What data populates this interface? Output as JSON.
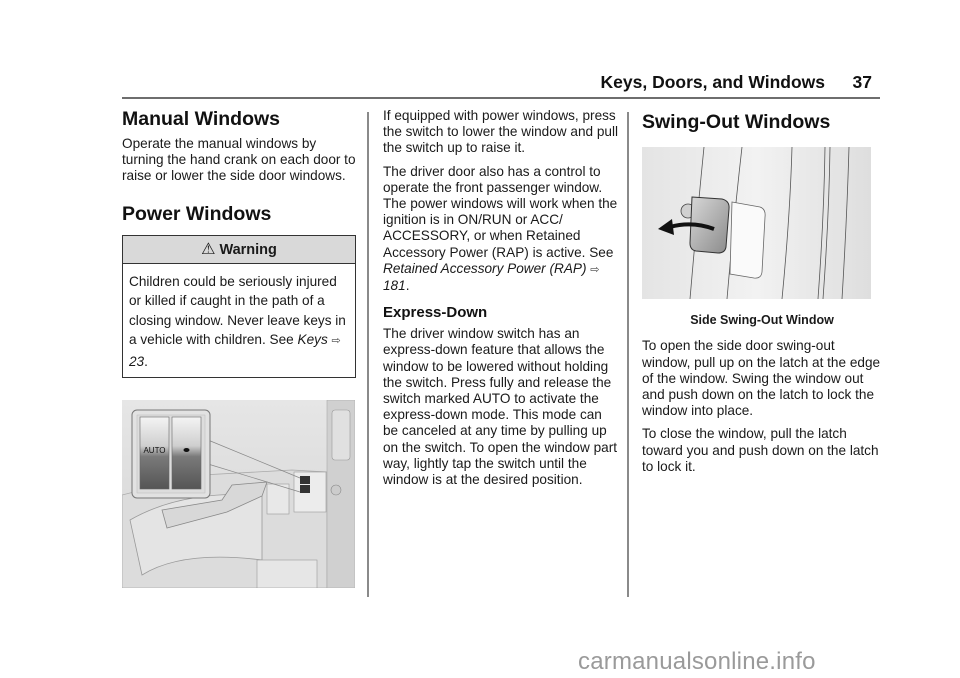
{
  "header": {
    "section_title": "Keys, Doors, and Windows",
    "page_number": "37"
  },
  "column1": {
    "manual_windows": {
      "heading": "Manual Windows",
      "body": "Operate the manual windows by turning the hand crank on each door to raise or lower the side door windows."
    },
    "power_windows": {
      "heading": "Power Windows",
      "warning": {
        "icon": "warning-triangle-icon",
        "title": "Warning",
        "body_prefix": "Children could be seriously injured or killed if caught in the path of a closing window. Never leave keys in a vehicle with children. See ",
        "xref_title": "Keys",
        "xref_arrow": "⇨",
        "xref_page": "23",
        "body_suffix": "."
      },
      "illustration": {
        "description": "Driver door power window switch panel",
        "switch_labels": [
          "AUTO",
          "●"
        ]
      }
    }
  },
  "column2": {
    "para1": "If equipped with power windows, press the switch to lower the window and pull the switch up to raise it.",
    "para2_prefix": "The driver door also has a control to operate the front passenger window. The power windows will work when the ignition is in ON/RUN or ACC/ ACCESSORY, or when Retained Accessory Power (RAP) is active. See ",
    "para2_xref_title": "Retained Accessory Power (RAP)",
    "para2_xref_arrow": "⇨",
    "para2_xref_page": "181",
    "para2_suffix": ".",
    "express_down": {
      "heading": "Express-Down",
      "body": "The driver window switch has an express-down feature that allows the window to be lowered without holding the switch. Press fully and release the switch marked AUTO to activate the express-down mode. This mode can be canceled at any time by pulling up on the switch. To open the window part way, lightly tap the switch until the window is at the desired position."
    }
  },
  "column3": {
    "heading": "Swing-Out Windows",
    "figure_caption": "Side Swing-Out Window",
    "para1": "To open the side door swing-out window, pull up on the latch at the edge of the window. Swing the window out and push down on the latch to lock the window into place.",
    "para2": "To close the window, pull the latch toward you and push down on the latch to lock it."
  },
  "watermark": "carmanualsonline.info"
}
